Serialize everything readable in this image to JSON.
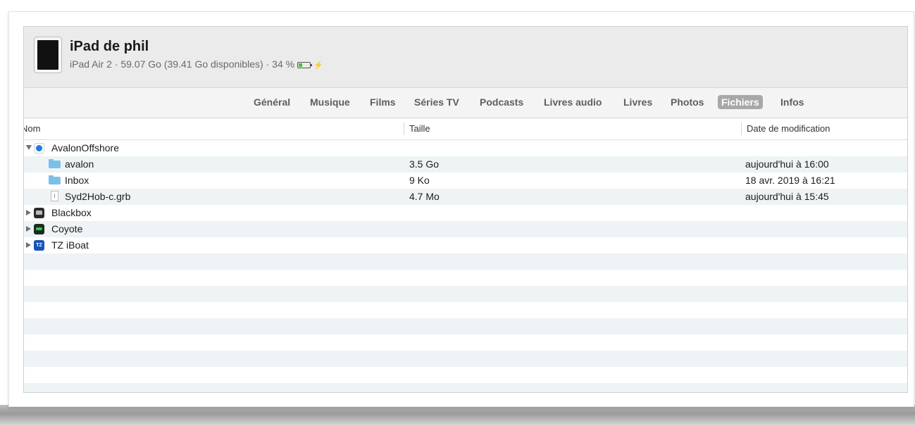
{
  "device": {
    "name": "iPad de phil",
    "info": "iPad Air 2 · 59.07 Go (39.41 Go disponibles) · 34 %",
    "battery_percent": 34,
    "battery_color": "#3ec43e"
  },
  "tabs": [
    {
      "label": "Général"
    },
    {
      "label": "Musique"
    },
    {
      "label": "Films"
    },
    {
      "label": "Séries TV"
    },
    {
      "label": "Podcasts"
    },
    {
      "label": "Livres audio"
    },
    {
      "label": "Livres"
    },
    {
      "label": "Photos"
    },
    {
      "label": "Fichiers",
      "active": true
    },
    {
      "label": "Infos"
    }
  ],
  "columns": {
    "name": "Nom",
    "size": "Taille",
    "date": "Date de modification"
  },
  "rows": [
    {
      "name": "AvalonOffshore",
      "size": "",
      "date": "",
      "icon": "avalon-app-icon",
      "expanded": true
    },
    {
      "name": "avalon",
      "size": "3.5 Go",
      "date": "aujourd'hui à 16:00",
      "icon": "folder-icon"
    },
    {
      "name": "Inbox",
      "size": "9 Ko",
      "date": "18 avr. 2019 à 16:21",
      "icon": "folder-icon"
    },
    {
      "name": "Syd2Hob-c.grb",
      "size": "4.7 Mo",
      "date": "aujourd'hui à 15:45",
      "icon": "file-icon"
    },
    {
      "name": "Blackbox",
      "size": "",
      "date": "",
      "icon": "blackbox-app-icon",
      "expanded": false
    },
    {
      "name": "Coyote",
      "size": "",
      "date": "",
      "icon": "coyote-app-icon",
      "expanded": false
    },
    {
      "name": "TZ iBoat",
      "size": "",
      "date": "",
      "icon": "tz-iboat-app-icon",
      "expanded": false
    }
  ],
  "app_icon_labels": {
    "tz": "TZ"
  },
  "colors": {
    "active_tab_bg": "#a8a8a8",
    "row_alt": "#eef3f6",
    "folder": "#7cc0ea"
  }
}
